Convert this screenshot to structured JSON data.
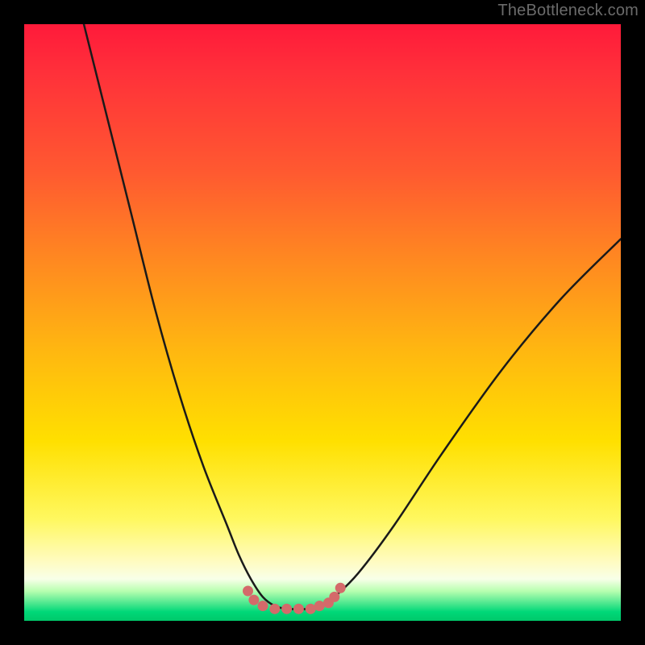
{
  "watermark": "TheBottleneck.com",
  "colors": {
    "frame": "#000000",
    "curve_stroke": "#1a1a1a",
    "marker_fill": "#d46a6a",
    "marker_stroke": "#c85a5a"
  },
  "chart_data": {
    "type": "line",
    "title": "",
    "xlabel": "",
    "ylabel": "",
    "xlim": [
      0,
      100
    ],
    "ylim": [
      0,
      100
    ],
    "grid": false,
    "note": "Heat-gradient bottleneck chart. Y-axis (vertical position in image) encodes bottleneck percentage: top=red=high bottleneck, bottom=green=low/zero bottleneck. X-axis is an unlabeled parameter sweep. Values below are read from the rendered curve; y is percent of chart height from bottom (0 = bottom/green, 100 = top/red).",
    "series": [
      {
        "name": "bottleneck-curve",
        "x": [
          10,
          14,
          18,
          22,
          26,
          30,
          34,
          36,
          38,
          40,
          42,
          44,
          46,
          48,
          50,
          52,
          56,
          62,
          70,
          80,
          90,
          100
        ],
        "y": [
          100,
          84,
          68,
          52,
          38,
          26,
          16,
          11,
          7,
          4,
          2.5,
          2,
          2,
          2,
          2.5,
          4,
          8,
          16,
          28,
          42,
          54,
          64
        ]
      }
    ],
    "markers": {
      "name": "valley-points",
      "note": "Small salmon-colored dots along the bottom of the valley",
      "x": [
        37.5,
        38.5,
        40,
        42,
        44,
        46,
        48,
        49.5,
        51,
        52,
        53
      ],
      "y": [
        5,
        3.5,
        2.5,
        2,
        2,
        2,
        2,
        2.5,
        3,
        4,
        5.5
      ]
    }
  }
}
